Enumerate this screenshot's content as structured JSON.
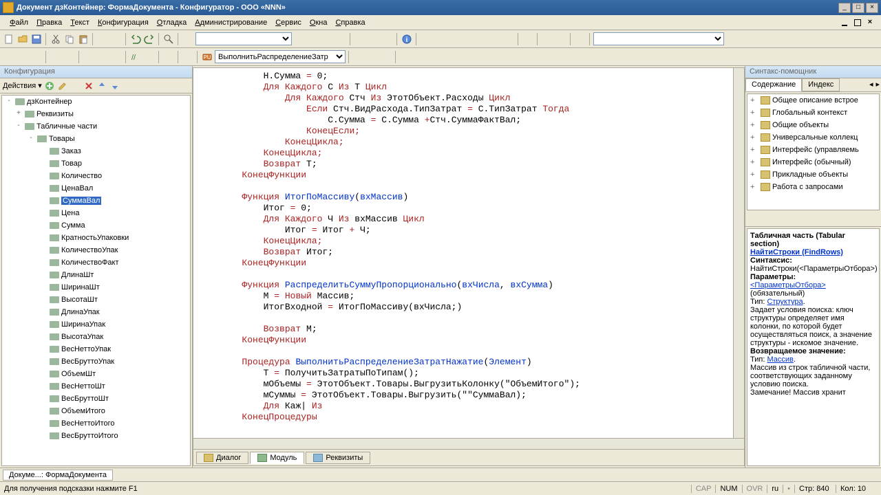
{
  "window": {
    "title": "Документ дзКонтейнер: ФормаДокумента - Конфигуратор - ООО «NNN»"
  },
  "menu": {
    "items": [
      "Файл",
      "Правка",
      "Текст",
      "Конфигурация",
      "Отладка",
      "Администрирование",
      "Сервис",
      "Окна",
      "Справка"
    ]
  },
  "toolbar2": {
    "combo": "ВыполнитьРаспределениеЗатр"
  },
  "left": {
    "panel_title": "Конфигурация",
    "actions_label": "Действия",
    "tree": [
      {
        "lvl": 0,
        "exp": "-",
        "label": "дзКонтейнер"
      },
      {
        "lvl": 1,
        "exp": "+",
        "label": "Реквизиты"
      },
      {
        "lvl": 1,
        "exp": "-",
        "label": "Табличные части"
      },
      {
        "lvl": 2,
        "exp": "-",
        "label": "Товары"
      },
      {
        "lvl": 3,
        "exp": "",
        "label": "Заказ"
      },
      {
        "lvl": 3,
        "exp": "",
        "label": "Товар"
      },
      {
        "lvl": 3,
        "exp": "",
        "label": "Количество"
      },
      {
        "lvl": 3,
        "exp": "",
        "label": "ЦенаВал"
      },
      {
        "lvl": 3,
        "exp": "",
        "label": "СуммаВал",
        "sel": true
      },
      {
        "lvl": 3,
        "exp": "",
        "label": "Цена"
      },
      {
        "lvl": 3,
        "exp": "",
        "label": "Сумма"
      },
      {
        "lvl": 3,
        "exp": "",
        "label": "КратностьУпаковки"
      },
      {
        "lvl": 3,
        "exp": "",
        "label": "КоличествоУпак"
      },
      {
        "lvl": 3,
        "exp": "",
        "label": "КоличествоФакт"
      },
      {
        "lvl": 3,
        "exp": "",
        "label": "ДлинаШт"
      },
      {
        "lvl": 3,
        "exp": "",
        "label": "ШиринаШт"
      },
      {
        "lvl": 3,
        "exp": "",
        "label": "ВысотаШт"
      },
      {
        "lvl": 3,
        "exp": "",
        "label": "ДлинаУпак"
      },
      {
        "lvl": 3,
        "exp": "",
        "label": "ШиринаУпак"
      },
      {
        "lvl": 3,
        "exp": "",
        "label": "ВысотаУпак"
      },
      {
        "lvl": 3,
        "exp": "",
        "label": "ВесНеттоУпак"
      },
      {
        "lvl": 3,
        "exp": "",
        "label": "ВесБруттоУпак"
      },
      {
        "lvl": 3,
        "exp": "",
        "label": "ОбъемШт"
      },
      {
        "lvl": 3,
        "exp": "",
        "label": "ВесНеттоШт"
      },
      {
        "lvl": 3,
        "exp": "",
        "label": "ВесБруттоШт"
      },
      {
        "lvl": 3,
        "exp": "",
        "label": "ОбъемИтого"
      },
      {
        "lvl": 3,
        "exp": "",
        "label": "ВесНеттоИтого"
      },
      {
        "lvl": 3,
        "exp": "",
        "label": "ВесБруттоИтого"
      }
    ]
  },
  "code_lines": [
    {
      "indent": 12,
      "spans": [
        [
          "ident",
          "Н.Сумма "
        ],
        [
          "kw",
          "= "
        ],
        [
          "num",
          "0"
        ],
        [
          "ident",
          ";"
        ]
      ]
    },
    {
      "indent": 12,
      "spans": [
        [
          "kw",
          "Для Каждого "
        ],
        [
          "ident",
          "С "
        ],
        [
          "kw",
          "Из "
        ],
        [
          "ident",
          "Т "
        ],
        [
          "kw",
          "Цикл"
        ]
      ]
    },
    {
      "indent": 16,
      "spans": [
        [
          "kw",
          "Для Каждого "
        ],
        [
          "ident",
          "Стч "
        ],
        [
          "kw",
          "Из "
        ],
        [
          "ident",
          "ЭтотОбъект.Расходы "
        ],
        [
          "kw",
          "Цикл"
        ]
      ]
    },
    {
      "indent": 20,
      "spans": [
        [
          "kw",
          "Если "
        ],
        [
          "ident",
          "Стч.ВидРасхода.ТипЗатрат "
        ],
        [
          "kw",
          "= "
        ],
        [
          "ident",
          "С.ТипЗатрат "
        ],
        [
          "kw",
          "Тогда"
        ]
      ]
    },
    {
      "indent": 24,
      "spans": [
        [
          "ident",
          "С.Сумма "
        ],
        [
          "kw",
          "= "
        ],
        [
          "ident",
          "С.Сумма "
        ],
        [
          "kw",
          "+"
        ],
        [
          "ident",
          "Стч.СуммаФактВал;"
        ]
      ]
    },
    {
      "indent": 20,
      "spans": [
        [
          "kw",
          "КонецЕсли;"
        ]
      ]
    },
    {
      "indent": 16,
      "spans": [
        [
          "kw",
          "КонецЦикла;"
        ]
      ]
    },
    {
      "indent": 12,
      "spans": [
        [
          "kw",
          "КонецЦикла;"
        ]
      ]
    },
    {
      "indent": 12,
      "spans": [
        [
          "kw",
          "Возврат "
        ],
        [
          "ident",
          "Т;"
        ]
      ]
    },
    {
      "indent": 8,
      "spans": [
        [
          "kw",
          "КонецФункции"
        ]
      ]
    },
    {
      "indent": 0,
      "spans": [
        [
          "ident",
          ""
        ]
      ]
    },
    {
      "indent": 8,
      "spans": [
        [
          "kw",
          "Функция "
        ],
        [
          "blue",
          "ИтогПоМассиву"
        ],
        [
          "ident",
          "("
        ],
        [
          "blue",
          "вхМассив"
        ],
        [
          "ident",
          ")"
        ]
      ]
    },
    {
      "indent": 12,
      "spans": [
        [
          "ident",
          "Итог "
        ],
        [
          "kw",
          "= "
        ],
        [
          "num",
          "0"
        ],
        [
          "ident",
          ";"
        ]
      ]
    },
    {
      "indent": 12,
      "spans": [
        [
          "kw",
          "Для Каждого "
        ],
        [
          "ident",
          "Ч "
        ],
        [
          "kw",
          "Из "
        ],
        [
          "ident",
          "вхМассив "
        ],
        [
          "kw",
          "Цикл"
        ]
      ]
    },
    {
      "indent": 16,
      "spans": [
        [
          "ident",
          "Итог "
        ],
        [
          "kw",
          "= "
        ],
        [
          "ident",
          "Итог "
        ],
        [
          "kw",
          "+ "
        ],
        [
          "ident",
          "Ч;"
        ]
      ]
    },
    {
      "indent": 12,
      "spans": [
        [
          "kw",
          "КонецЦикла;"
        ]
      ]
    },
    {
      "indent": 12,
      "spans": [
        [
          "kw",
          "Возврат "
        ],
        [
          "ident",
          "Итог;"
        ]
      ]
    },
    {
      "indent": 8,
      "spans": [
        [
          "kw",
          "КонецФункции"
        ]
      ]
    },
    {
      "indent": 0,
      "spans": [
        [
          "ident",
          ""
        ]
      ]
    },
    {
      "indent": 8,
      "spans": [
        [
          "kw",
          "Функция "
        ],
        [
          "blue",
          "РаспределитьСуммуПропорционально"
        ],
        [
          "ident",
          "("
        ],
        [
          "blue",
          "вхЧисла"
        ],
        [
          "ident",
          ", "
        ],
        [
          "blue",
          "вхСумма"
        ],
        [
          "ident",
          ")"
        ]
      ]
    },
    {
      "indent": 12,
      "spans": [
        [
          "ident",
          "М "
        ],
        [
          "kw",
          "= Новый "
        ],
        [
          "ident",
          "Массив;"
        ]
      ]
    },
    {
      "indent": 12,
      "spans": [
        [
          "ident",
          "ИтогВходной "
        ],
        [
          "kw",
          "= "
        ],
        [
          "ident",
          "ИтогПоМассиву(вхЧисла;)"
        ]
      ]
    },
    {
      "indent": 0,
      "spans": [
        [
          "ident",
          ""
        ]
      ]
    },
    {
      "indent": 12,
      "spans": [
        [
          "kw",
          "Возврат "
        ],
        [
          "ident",
          "М;"
        ]
      ]
    },
    {
      "indent": 8,
      "spans": [
        [
          "kw",
          "КонецФункции"
        ]
      ]
    },
    {
      "indent": 0,
      "spans": [
        [
          "ident",
          ""
        ]
      ]
    },
    {
      "indent": 8,
      "spans": [
        [
          "kw",
          "Процедура "
        ],
        [
          "blue",
          "ВыполнитьРаспределениеЗатратНажатие"
        ],
        [
          "ident",
          "("
        ],
        [
          "blue",
          "Элемент"
        ],
        [
          "ident",
          ")"
        ]
      ]
    },
    {
      "indent": 12,
      "spans": [
        [
          "ident",
          "Т "
        ],
        [
          "kw",
          "= "
        ],
        [
          "ident",
          "ПолучитьЗатратыПоТипам();"
        ]
      ]
    },
    {
      "indent": 12,
      "spans": [
        [
          "ident",
          "мОбъемы "
        ],
        [
          "kw",
          "= "
        ],
        [
          "ident",
          "ЭтотОбъект.Товары.ВыгрузитьКолонку(\"ОбъемИтого\");"
        ]
      ]
    },
    {
      "indent": 12,
      "spans": [
        [
          "ident",
          "мСуммы "
        ],
        [
          "kw",
          "= "
        ],
        [
          "ident",
          "ЭтотОбъект.Товары.Выгрузить(\"\"СуммаВал);"
        ]
      ]
    },
    {
      "indent": 12,
      "spans": [
        [
          "kw",
          "Для "
        ],
        [
          "ident",
          "Каж| "
        ],
        [
          "kw",
          "Из"
        ]
      ]
    },
    {
      "indent": 8,
      "spans": [
        [
          "kw",
          "КонецПроцедуры"
        ]
      ]
    }
  ],
  "bottom_tabs": [
    {
      "label": "Диалог"
    },
    {
      "label": "Модуль",
      "active": true
    },
    {
      "label": "Реквизиты"
    }
  ],
  "right": {
    "panel_title": "Синтакс-помощник",
    "tabs": [
      {
        "label": "Содержание",
        "active": true
      },
      {
        "label": "Индекс"
      }
    ],
    "tree": [
      "Общее описание встрое",
      "Глобальный контекст",
      "Общие объекты",
      "Универсальные коллекц",
      "Интерфейс (управляемь",
      "Интерфейс (обычный)",
      "Прикладные объекты",
      "Работа с запросами"
    ],
    "help": {
      "title1": "Табличная часть (Tabular section)",
      "title2": "НайтиСтроки (FindRows)",
      "syntax_label": "Синтаксис:",
      "syntax": "НайтиСтроки(<ПараметрыОтбора>)",
      "params_label": "Параметры:",
      "param_name": "<ПараметрыОтбора>",
      "req": "(обязательный)",
      "type_label": "Тип: ",
      "type_link": "Структура",
      "desc": "Задает условия поиска: ключ структуры определяет имя колонки, по которой будет осуществляться поиск, а значение структуры - искомое значение.",
      "ret_label": "Возвращаемое значение:",
      "ret_type_link": "Массив",
      "ret_desc": "Массив из строк табличной части, соответствующих заданному условию поиска.",
      "note": "Замечание! Массив хранит"
    }
  },
  "doctab": "Докуме...: ФормаДокумента",
  "status": {
    "hint": "Для получения подсказки нажмите F1",
    "cap": "CAP",
    "num": "NUM",
    "ovr": "OVR",
    "lang": "ru",
    "line": "Стр: 840",
    "col": "Кол: 10"
  }
}
